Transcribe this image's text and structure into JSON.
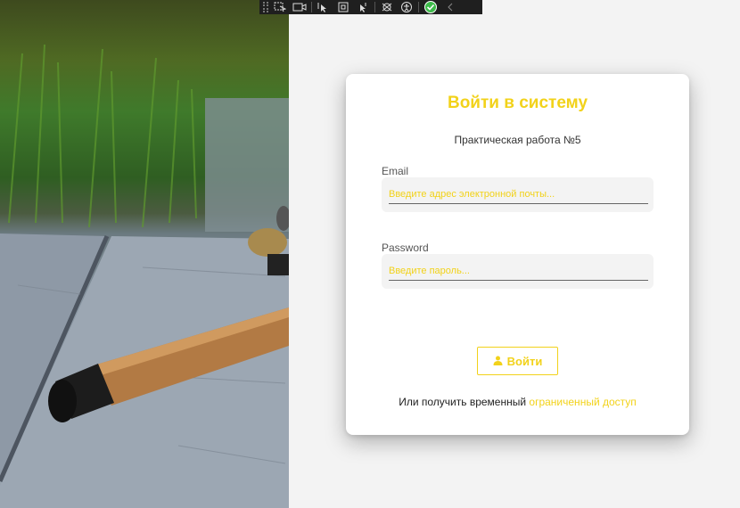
{
  "login": {
    "title": "Войти в систему",
    "subtitle": "Практическая работа №5",
    "email": {
      "label": "Email",
      "placeholder": "Введите адрес электронной почты...",
      "value": ""
    },
    "password": {
      "label": "Password",
      "placeholder": "Введите пароль...",
      "value": ""
    },
    "submit_label": "Войти",
    "footer": {
      "text": "Или получить временный",
      "link": "ограниченный доступ"
    }
  },
  "devbar": {
    "tools": [
      "select-element-icon",
      "video-icon",
      "pointer-icon",
      "frame-icon",
      "pointer-refresh-icon",
      "ruler-icon",
      "accessibility-icon",
      "check-icon",
      "collapse-chevron-icon"
    ]
  },
  "colors": {
    "accent": "#f2d21a",
    "background": "#f3f3f3",
    "card": "#ffffff"
  }
}
